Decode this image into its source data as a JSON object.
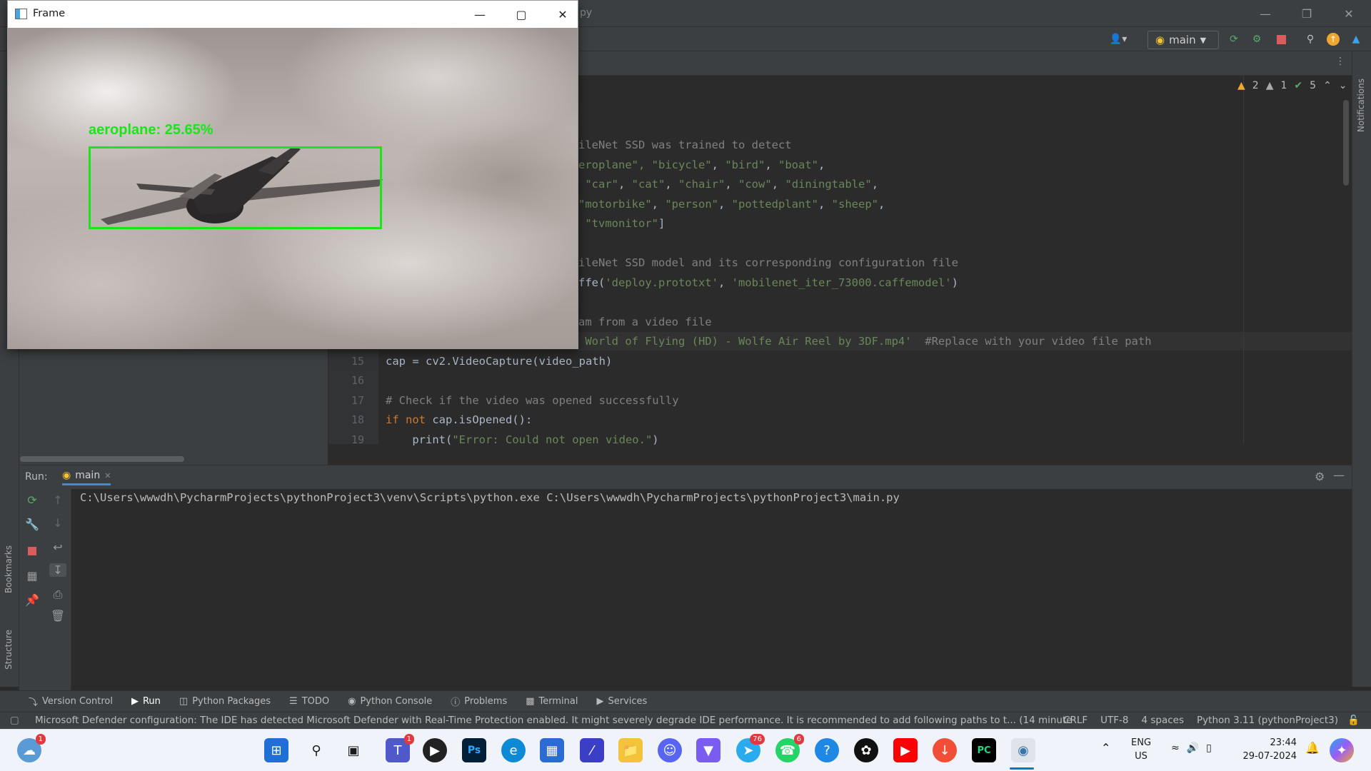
{
  "ide": {
    "window_title_fragment": "py",
    "run_config": "main",
    "inspections": {
      "warnings": "2",
      "weak_warnings": "1",
      "ok": "5"
    },
    "notifications_label": "Notifications",
    "bookmarks_label": "Bookmarks",
    "structure_label": "Structure",
    "code_lines": [
      {
        "num": "",
        "html_parts": [
          {
            "t": "ileNet SSD was trained to detect",
            "c": "cmt"
          }
        ]
      },
      {
        "num": "",
        "html_parts": [
          {
            "t": "eroplane\", ",
            "c": "str"
          },
          {
            "t": "\"bicycle\"",
            "c": "str"
          },
          {
            "t": ", ",
            "c": ""
          },
          {
            "t": "\"bird\"",
            "c": "str"
          },
          {
            "t": ", ",
            "c": ""
          },
          {
            "t": "\"boat\"",
            "c": "str"
          },
          {
            "t": ",",
            "c": ""
          }
        ]
      },
      {
        "num": "",
        "html_parts": [
          {
            "t": " \"car\"",
            "c": "str"
          },
          {
            "t": ", ",
            "c": ""
          },
          {
            "t": "\"cat\"",
            "c": "str"
          },
          {
            "t": ", ",
            "c": ""
          },
          {
            "t": "\"chair\"",
            "c": "str"
          },
          {
            "t": ", ",
            "c": ""
          },
          {
            "t": "\"cow\"",
            "c": "str"
          },
          {
            "t": ", ",
            "c": ""
          },
          {
            "t": "\"diningtable\"",
            "c": "str"
          },
          {
            "t": ",",
            "c": ""
          }
        ]
      },
      {
        "num": "",
        "html_parts": [
          {
            "t": "\"motorbike\"",
            "c": "str"
          },
          {
            "t": ", ",
            "c": ""
          },
          {
            "t": "\"person\"",
            "c": "str"
          },
          {
            "t": ", ",
            "c": ""
          },
          {
            "t": "\"pottedplant\"",
            "c": "str"
          },
          {
            "t": ", ",
            "c": ""
          },
          {
            "t": "\"sheep\"",
            "c": "str"
          },
          {
            "t": ",",
            "c": ""
          }
        ]
      },
      {
        "num": "",
        "html_parts": [
          {
            "t": " \"tvmonitor\"",
            "c": "str"
          },
          {
            "t": "]",
            "c": ""
          }
        ]
      },
      {
        "num": "",
        "html_parts": []
      },
      {
        "num": "",
        "html_parts": [
          {
            "t": "ileNet SSD model and its corresponding configuration file",
            "c": "cmt"
          }
        ]
      },
      {
        "num": "",
        "html_parts": [
          {
            "t": "ffe(",
            "c": ""
          },
          {
            "t": "'deploy.prototxt'",
            "c": "str"
          },
          {
            "t": ", ",
            "c": ""
          },
          {
            "t": "'mobilenet_iter_73000.caffemodel'",
            "c": "str"
          },
          {
            "t": ")",
            "c": ""
          }
        ]
      },
      {
        "num": "",
        "html_parts": []
      },
      {
        "num": "",
        "html_parts": [
          {
            "t": "am from a video file",
            "c": "cmt"
          }
        ]
      },
      {
        "num": "",
        "html_parts": [
          {
            "t": " World of Flying (HD) - Wolfe Air Reel by 3DF.mp4'",
            "c": "str"
          },
          {
            "t": "  ",
            "c": ""
          },
          {
            "t": "#Replace with your video file path",
            "c": "cmt"
          }
        ]
      },
      {
        "num": "15",
        "html_parts": [
          {
            "t": "cap = cv2.VideoCapture(video_path)",
            "c": ""
          }
        ]
      },
      {
        "num": "16",
        "html_parts": []
      },
      {
        "num": "17",
        "html_parts": [
          {
            "t": "# Check if the video was opened successfully",
            "c": "cmt"
          }
        ]
      },
      {
        "num": "18",
        "html_parts": [
          {
            "t": "if not ",
            "c": "kw"
          },
          {
            "t": "cap.isOpened():",
            "c": ""
          }
        ]
      },
      {
        "num": "19",
        "html_parts": [
          {
            "t": "    print(",
            "c": ""
          },
          {
            "t": "\"Error: Could not open video.\"",
            "c": "str"
          },
          {
            "t": ")",
            "c": ""
          }
        ]
      }
    ],
    "run_panel": {
      "label": "Run:",
      "tab": "main",
      "command": "C:\\Users\\wwwdh\\PycharmProjects\\pythonProject3\\venv\\Scripts\\python.exe C:\\Users\\wwwdh\\PycharmProjects\\pythonProject3\\main.py"
    },
    "tool_tabs": [
      "Version Control",
      "Run",
      "Python Packages",
      "TODO",
      "Python Console",
      "Problems",
      "Terminal",
      "Services"
    ],
    "active_tool_tab": "Run",
    "status": {
      "message": "Microsoft Defender configuration: The IDE has detected Microsoft Defender with Real-Time Protection enabled. It might severely degrade IDE performance. It is recommended to add following paths to t... (14 minute",
      "line_sep": "CRLF",
      "encoding": "UTF-8",
      "indent": "4 spaces",
      "interpreter": "Python 3.11 (pythonProject3)"
    }
  },
  "frame_window": {
    "title": "Frame",
    "detection_label": "aeroplane: 25.65%",
    "detection_confidence_percent": 25.65
  },
  "taskbar": {
    "lang": "ENG",
    "region": "US",
    "time": "23:44",
    "date": "29-07-2024",
    "badges": {
      "weather": "1",
      "teams": "1",
      "telegram": "76",
      "whatsapp": "6"
    }
  }
}
